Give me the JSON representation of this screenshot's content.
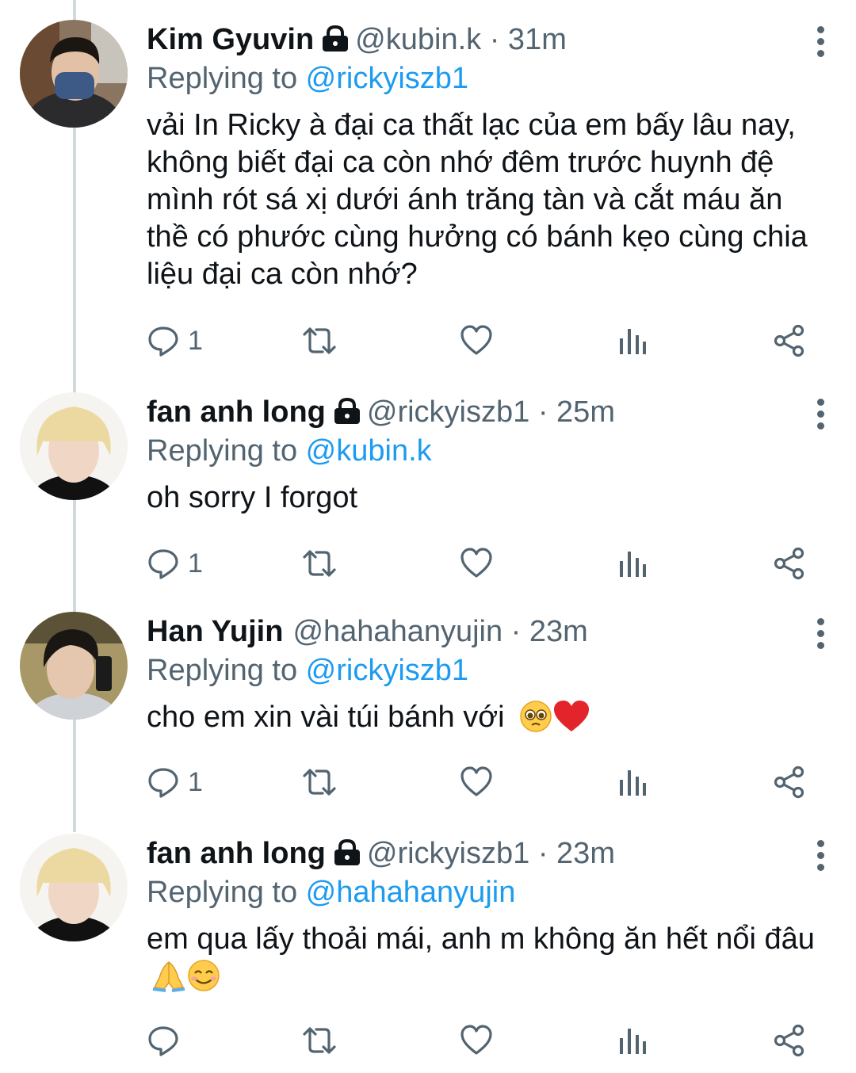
{
  "tweets": [
    {
      "name": "Kim Gyuvin",
      "handle": "@kubin.k",
      "time": "31m",
      "replying_label": "Replying to ",
      "replying_to": "@rickyiszb1",
      "text": "vải In Ricky à đại ca thất lạc của em bấy lâu nay, không biết đại ca còn nhớ đêm trước huynh đệ mình rót sá xị dưới ánh trăng tàn và cắt máu ăn thề có phước cùng hưởng có bánh kẹo cùng chia liệu đại ca còn nhớ?",
      "reply_count": "1"
    },
    {
      "name": "fan anh long",
      "handle": "@rickyiszb1",
      "time": "25m",
      "replying_label": "Replying to ",
      "replying_to": "@kubin.k",
      "text": "oh sorry I forgot",
      "reply_count": "1"
    },
    {
      "name": "Han Yujin",
      "handle": "@hahahanyujin",
      "time": "23m",
      "replying_label": "Replying to ",
      "replying_to": "@rickyiszb1",
      "text": "cho em xin vài túi bánh với",
      "reply_count": "1"
    },
    {
      "name": "fan anh long",
      "handle": "@rickyiszb1",
      "time": "23m",
      "replying_label": "Replying to ",
      "replying_to": "@hahahanyujin",
      "text": "em qua lấy thoải mái, anh m không ăn hết nổi đâu",
      "reply_count": ""
    }
  ],
  "separator": " · ",
  "icons": [
    "lock-icon",
    "more-icon",
    "reply-icon",
    "retweet-icon",
    "like-icon",
    "analytics-icon",
    "share-icon",
    "pleading-face-emoji",
    "red-heart-emoji",
    "folded-hands-emoji",
    "smiling-face-emoji"
  ],
  "colors": {
    "link": "#1d9bf0",
    "muted": "#536471",
    "text": "#0f1419",
    "thread_line": "#cfd9de"
  }
}
